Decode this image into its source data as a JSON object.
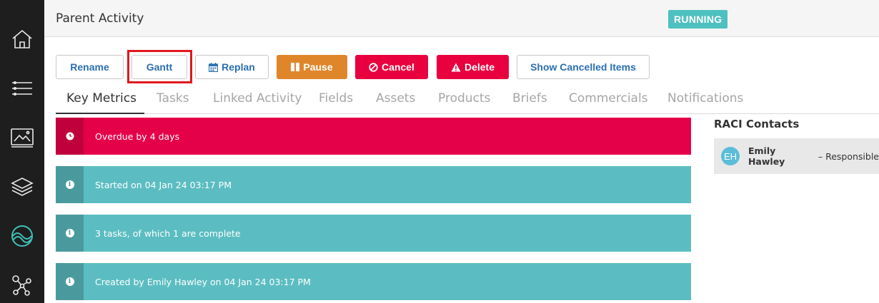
{
  "header": {
    "title": "Parent Activity",
    "status": "RUNNING",
    "status_color": "#4fc0c0"
  },
  "sidebar": {
    "items": [
      {
        "icon": "home-icon"
      },
      {
        "icon": "list-icon"
      },
      {
        "icon": "image-monitor-icon"
      },
      {
        "icon": "layers-icon"
      },
      {
        "icon": "brand-logo-icon"
      },
      {
        "icon": "network-icon"
      }
    ]
  },
  "toolbar": {
    "rename_label": "Rename",
    "gantt_label": "Gantt",
    "replan_label": "Replan",
    "pause_label": "Pause",
    "cancel_label": "Cancel",
    "delete_label": "Delete",
    "show_cancelled_label": "Show Cancelled Items"
  },
  "tabs": [
    {
      "label": "Key Metrics",
      "active": true
    },
    {
      "label": "Tasks"
    },
    {
      "label": "Linked Activity"
    },
    {
      "label": "Fields"
    },
    {
      "label": "Assets"
    },
    {
      "label": "Products"
    },
    {
      "label": "Briefs"
    },
    {
      "label": "Commercials"
    },
    {
      "label": "Notifications"
    }
  ],
  "metrics": [
    {
      "text": "Overdue by 4 days",
      "type": "alert",
      "icon": "clock-icon"
    },
    {
      "text": "Started on 04 Jan 24 03:17 PM",
      "type": "info",
      "icon": "info-icon"
    },
    {
      "text": "3 tasks, of which 1 are complete",
      "type": "info",
      "icon": "info-icon"
    },
    {
      "text": "Created by Emily Hawley on 04 Jan 24 03:17 PM",
      "type": "info",
      "icon": "info-icon"
    }
  ],
  "raci": {
    "title": "RACI Contacts",
    "contacts": [
      {
        "initials": "EH",
        "name": "Emily Hawley",
        "separator": "–",
        "role": "Responsible"
      }
    ]
  },
  "colors": {
    "accent_blue": "#2a6fb0",
    "alert_red": "#e5004a",
    "info_teal": "#5bbdc1",
    "pause_orange": "#e0862a",
    "highlight_red": "#e0181e"
  }
}
